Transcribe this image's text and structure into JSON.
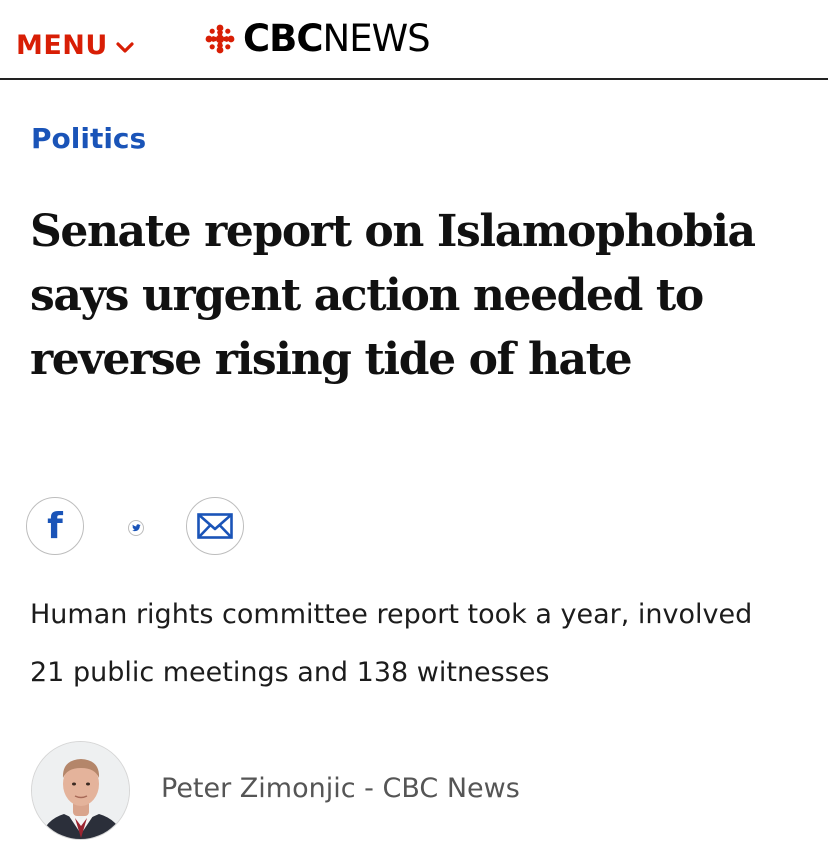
{
  "header": {
    "menu_label": "MENU",
    "logo_cbc": "CBC",
    "logo_news": "NEWS"
  },
  "article": {
    "section": "Politics",
    "headline": "Senate report on Islamophobia says urgent action needed to reverse rising tide of hate",
    "deck": "Human rights committee report took a year, involved 21 public meetings and 138 witnesses",
    "byline": "Peter Zimonjic - CBC News"
  },
  "share": {
    "facebook_glyph": "f",
    "icons": [
      "facebook-icon",
      "twitter-icon",
      "email-icon"
    ]
  },
  "colors": {
    "brand_red": "#d81e05",
    "section_blue": "#1a54b8",
    "share_blue": "#1a54b8",
    "byline_gray": "#555555"
  }
}
